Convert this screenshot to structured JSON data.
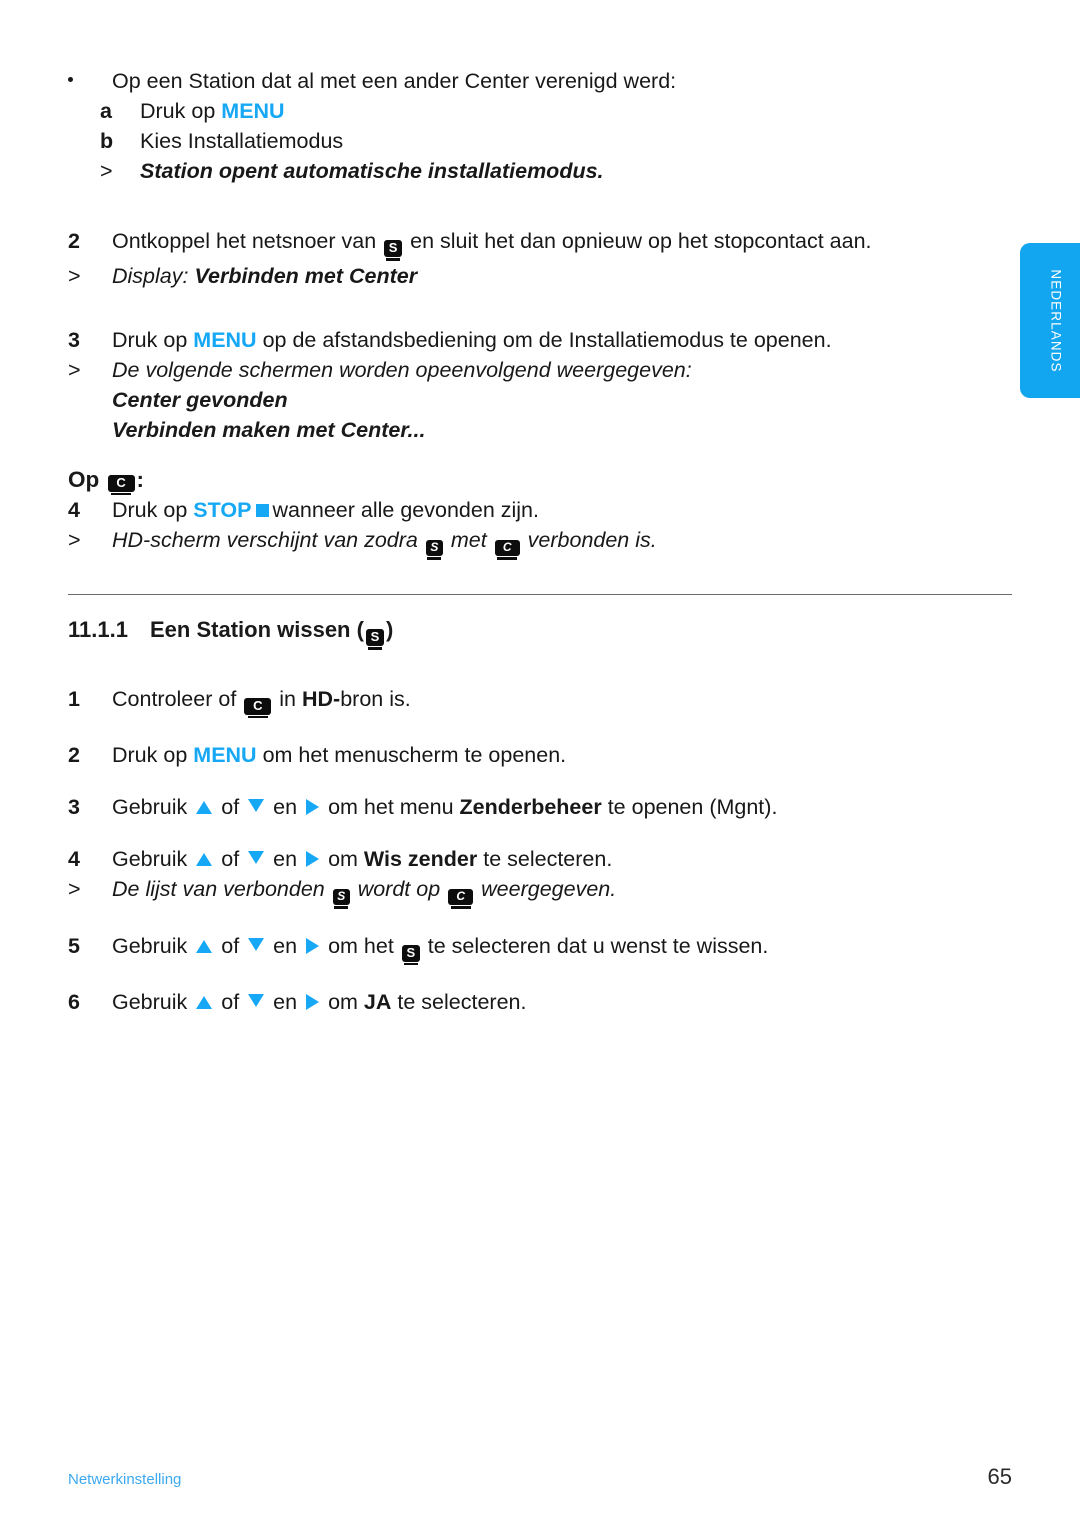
{
  "language_tab": {
    "label": "NEDERLANDS",
    "color": "#12a6f0"
  },
  "colors": {
    "accent_blue": "#16a8f5",
    "footer_blue": "#3ba9ef",
    "icon_black": "#0d0d0d"
  },
  "icons": {
    "station_letter": "S",
    "center_letter": "C"
  },
  "top_block": {
    "bullet_text": "Op een Station dat al met een ander Center verenigd werd:",
    "sub_a_marker": "a",
    "sub_a_text": "Druk op",
    "sub_a_key": "MENU",
    "sub_b_marker": "b",
    "sub_b_text": "Kies Installatiemodus",
    "sub_note_marker": ">",
    "sub_note_text": "Station opent automatische installatiemodus."
  },
  "step2": {
    "marker": "2",
    "text_before_icon": "Ontkoppel het netsnoer van",
    "text_after_icon": "en sluit het dan opnieuw op het stopcontact aan.",
    "note_marker": ">",
    "note_label": "Display:",
    "note_value": "Verbinden met Center"
  },
  "step3": {
    "marker": "3",
    "text_before_key": "Druk op",
    "key": "MENU",
    "text_after_key": "op de afstandsbediening om de Installatiemodus te openen.",
    "note_marker": ">",
    "note_text": "De volgende schermen worden opeenvolgend weergegeven:",
    "screen1": "Center gevonden",
    "screen2": "Verbinden maken met Center..."
  },
  "op_center": {
    "prefix": "Op",
    "suffix": ":"
  },
  "step4": {
    "marker": "4",
    "text_before_key": "Druk op",
    "key": "STOP",
    "text_after_key": "wanneer alle  gevonden zijn.",
    "note_marker": ">",
    "note_before": "HD-scherm verschijnt van zodra",
    "note_middle": "met",
    "note_after": "verbonden is."
  },
  "section": {
    "number": "11.1.1",
    "title_before_icon": "Een Station wissen (",
    "title_after_icon": ")"
  },
  "steps": [
    {
      "marker": "1",
      "parts": [
        {
          "type": "text",
          "value": "Controleer of"
        },
        {
          "type": "icon",
          "value": "C"
        },
        {
          "type": "text",
          "value": "in"
        },
        {
          "type": "bold",
          "value": "HD-"
        },
        {
          "type": "text",
          "value": "bron is."
        }
      ]
    },
    {
      "marker": "2",
      "before": "Druk op",
      "key": "MENU",
      "after": "om het menuscherm te openen."
    },
    {
      "marker": "3",
      "use": "Gebruik",
      "of": "of",
      "en": "en",
      "om": "om het menu",
      "bold": "Zenderbeheer",
      "tail": "te openen (Mgnt)."
    },
    {
      "marker": "4",
      "use": "Gebruik",
      "of": "of",
      "en": "en",
      "om": "om",
      "bold": "Wis zender",
      "tail": "te selecteren."
    },
    {
      "marker": ">",
      "note_before": "De lijst van verbonden",
      "note_middle": "wordt op",
      "note_after": "weergegeven."
    },
    {
      "marker": "5",
      "use": "Gebruik",
      "of": "of",
      "en": "en",
      "om": "om het",
      "tail": "te selecteren dat u wenst te wissen."
    },
    {
      "marker": "6",
      "use": "Gebruik",
      "of": "of",
      "en": "en",
      "om": "om",
      "bold": "JA",
      "tail": "te selecteren."
    }
  ],
  "footer": {
    "left": "Netwerkinstelling",
    "right": "65"
  }
}
